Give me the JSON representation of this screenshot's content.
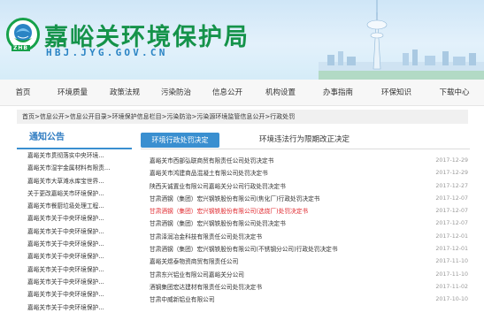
{
  "header": {
    "title": "嘉峪关环境保护局",
    "domain": "HBJ.JYG.GOV.CN",
    "logo_text": "ZHB"
  },
  "nav": {
    "items": [
      "首页",
      "环境质量",
      "政策法规",
      "污染防治",
      "信息公开",
      "机构设置",
      "办事指南",
      "环保知识",
      "下载中心"
    ]
  },
  "breadcrumb": "首页>信息公开>信息公开目录>环境保护信息栏目>污染防治>污染源环境监管信息公开>行政处罚",
  "sidebar": {
    "title": "通知公告",
    "items": [
      "嘉峪关市贯彻落实中央环境...",
      "嘉峪关市湿宇金属材料有限责...",
      "嘉峪关市大草滩水库宝世界...",
      "关于更改嘉峪关市环境保护...",
      "嘉峪关市餐厨垃圾处理工程...",
      "嘉峪关市关于中央环境保护...",
      "嘉峪关市关于中央环境保护...",
      "嘉峪关市关于中央环境保护...",
      "嘉峪关市关于中央环境保护...",
      "嘉峪关市关于中央环境保护...",
      "嘉峪关市关于中央环境保护...",
      "嘉峪关市关于中央环境保护...",
      "嘉峪关市关于中央环境保护..."
    ]
  },
  "tabs": {
    "active": "环境行政处罚决定",
    "inactive": "环境违法行为限期改正决定"
  },
  "documents": [
    {
      "title": "嘉峪关市西部弘联商贸有限责任公司处罚决定书",
      "date": "2017-12-29",
      "highlight": false
    },
    {
      "title": "嘉峪关市鸿建商品混凝土有限公司处罚决定书",
      "date": "2017-12-29",
      "highlight": false
    },
    {
      "title": "陕西天诚置业有限公司嘉峪关分公司行政处罚决定书",
      "date": "2017-12-27",
      "highlight": false
    },
    {
      "title": "甘肃酒钢（集团）宏兴钢铁股份有限公司(焦化厂)行政处罚决定书",
      "date": "2017-12-07",
      "highlight": false
    },
    {
      "title": "甘肃酒钢（集团）宏兴钢铁股份有限公司(选烧厂)处罚决定书",
      "date": "2017-12-07",
      "highlight": true
    },
    {
      "title": "甘肃酒钢（集团）宏兴钢铁股份有限公司处罚决定书",
      "date": "2017-12-07",
      "highlight": false
    },
    {
      "title": "甘肃泽润冶金科技有限责任公司处罚决定书",
      "date": "2017-12-01",
      "highlight": false
    },
    {
      "title": "甘肃酒钢（集团）宏兴钢铁股份有限公司(不锈钢分公司)行政处罚决定书",
      "date": "2017-12-01",
      "highlight": false
    },
    {
      "title": "嘉峪关煜泰物资商贸有限责任公司",
      "date": "2017-11-10",
      "highlight": false
    },
    {
      "title": "甘肃东兴铝业有限公司嘉峪关分公司",
      "date": "2017-11-10",
      "highlight": false
    },
    {
      "title": "酒钢集团宏达建材有限责任公司处罚决定书",
      "date": "2017-11-02",
      "highlight": false
    },
    {
      "title": "甘肃中威新铝业有限公司",
      "date": "2017-10-10",
      "highlight": false
    }
  ]
}
